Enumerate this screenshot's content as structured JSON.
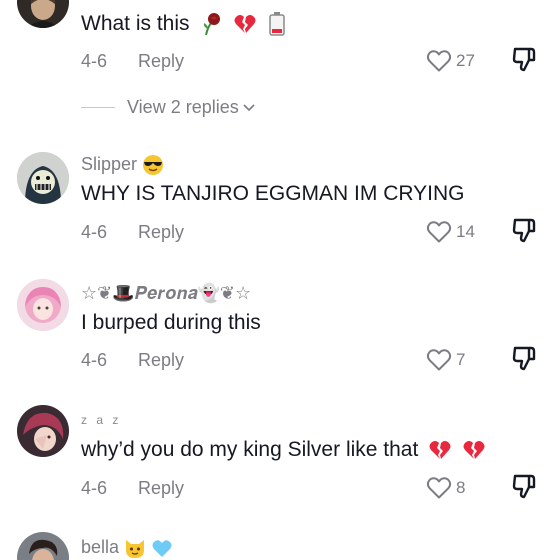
{
  "comments": [
    {
      "username": "",
      "text": "What is this",
      "text_emoji": [
        "rose-icon",
        "broken-heart-icon",
        "low-battery-icon"
      ],
      "date": "4-6",
      "reply_label": "Reply",
      "likes": "27",
      "view_replies": "View 2 replies"
    },
    {
      "username": "Slipper",
      "username_emoji": [
        "sunglasses-face-icon"
      ],
      "text": "WHY IS TANJIRO EGGMAN IM CRYING",
      "date": "4-6",
      "reply_label": "Reply",
      "likes": "14"
    },
    {
      "username": "☆❦🎩𝑷𝒆𝒓𝒐𝒏𝒂👻❦☆",
      "text": "I burped during this",
      "date": "4-6",
      "reply_label": "Reply",
      "likes": "7"
    },
    {
      "username": "z a z",
      "text": "why’d you do my king Silver like that",
      "text_emoji": [
        "broken-heart-icon",
        "broken-heart-icon"
      ],
      "date": "4-6",
      "reply_label": "Reply",
      "likes": "8"
    },
    {
      "username": "bella",
      "username_emoji": [
        "cat-face-icon",
        "blue-heart-icon"
      ]
    }
  ],
  "colors": {
    "text": "#161823",
    "secondary": "#7c7d83",
    "heart_red": "#e8283f",
    "blue_heart": "#6ecbf5"
  }
}
